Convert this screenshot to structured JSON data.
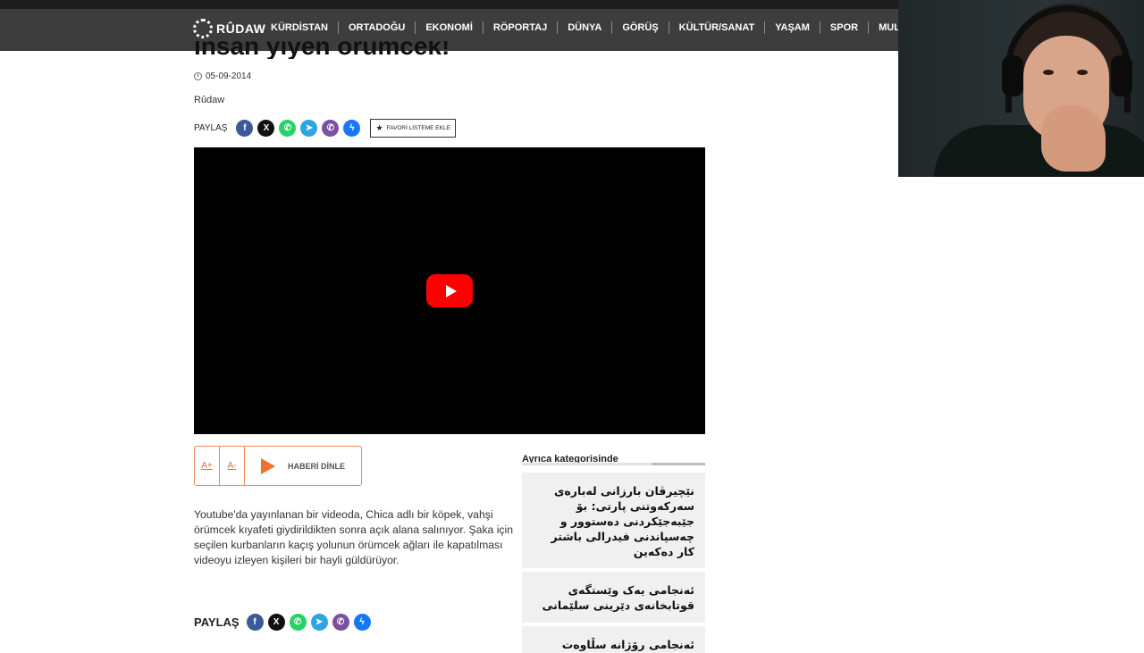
{
  "nav": {
    "logo_text": "RÛDAW",
    "items": [
      "KÜRDİSTAN",
      "ORTADOĞU",
      "EKONOMİ",
      "RÖPORTAJ",
      "DÜNYA",
      "GÖRÜŞ",
      "KÜLTÜR/SANAT",
      "YAŞAM",
      "SPOR",
      "MULTİMEDYA"
    ]
  },
  "article": {
    "title": "İnsan yiyen örümcek!",
    "date": "05-09-2014",
    "author": "Rûdaw",
    "share_label": "PAYLAŞ",
    "favorite_label": "FAVORİ LİSTEME EKLE",
    "font_increase": "A+",
    "font_decrease": "A-",
    "listen_label": "HABERİ DİNLE",
    "body": "Youtube'da yayınlanan bir videoda, Chica adlı bir köpek, vahşi örümcek kıyafeti giydirildikten sonra açık alana salınıyor. Şaka için seçilen kurbanların kaçış yolunun örümcek ağları ile kapatılması videoyu izleyen kişileri bir hayli güldürüyor.",
    "share_label_bottom": "PAYLAŞ"
  },
  "share_icons": [
    {
      "name": "facebook-icon",
      "glyph": "f",
      "color": "#3b5998"
    },
    {
      "name": "x-icon",
      "glyph": "𝕏",
      "color": "#111111"
    },
    {
      "name": "whatsapp-icon",
      "glyph": "✆",
      "color": "#25d366"
    },
    {
      "name": "telegram-icon",
      "glyph": "➤",
      "color": "#2ca5e0"
    },
    {
      "name": "viber-icon",
      "glyph": "✆",
      "color": "#7b519d"
    },
    {
      "name": "messenger-icon",
      "glyph": "ϟ",
      "color": "#1877f2"
    }
  ],
  "sidebar": {
    "title": "Ayrıca kategorisinde",
    "cards": [
      "نێچیرڤان بارزانی لەبارەی سەرکەوتنی پارتی: بۆ جێبەجێکردنی دەستوور و چەسپاندنی فیدرالی باشتر کار دەکەین",
      "ئەنجامی یەک وێستگەی قوتابخانەی دێرینی سلێمانی",
      "ئەنجامی رۆژانە سڵاوەت پەیوەندی"
    ]
  },
  "colors": {
    "nav_bg": "#3d3d3d",
    "accent": "#f07030",
    "youtube": "#ff0000"
  }
}
